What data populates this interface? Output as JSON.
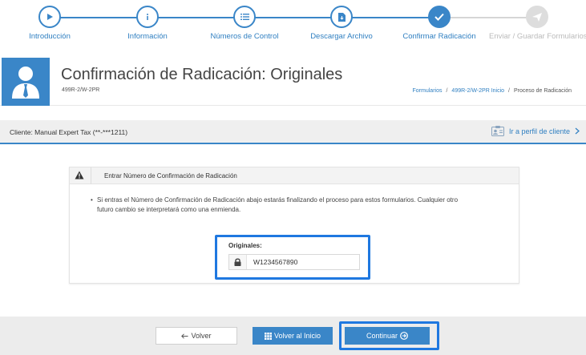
{
  "stepper": {
    "steps": [
      {
        "label": "Introducción",
        "icon": "play-icon",
        "state": "done"
      },
      {
        "label": "Información",
        "icon": "info-icon",
        "state": "done"
      },
      {
        "label": "Números de Control",
        "icon": "list-icon",
        "state": "done"
      },
      {
        "label": "Descargar Archivo",
        "icon": "file-download-icon",
        "state": "done"
      },
      {
        "label": "Confirmar Radicación",
        "icon": "check-icon",
        "state": "active"
      },
      {
        "label": "Enviar / Guardar Formularios",
        "icon": "send-icon",
        "state": "disabled"
      }
    ]
  },
  "header": {
    "title": "Confirmación de Radicación: Originales",
    "subtitle": "499R-2/W-2PR",
    "breadcrumb": [
      {
        "label": "Formularios",
        "link": true
      },
      {
        "label": "499R-2/W-2PR Inicio",
        "link": true
      },
      {
        "label": "Proceso de Radicación",
        "link": false
      }
    ]
  },
  "client": {
    "text": "Cliente: Manual Expert Tax (**-***1211)",
    "profile_link": "Ir a perfil de cliente"
  },
  "panel": {
    "title": "Entrar Número de Confirmación de Radicación",
    "message": "Si entras el Número de Confirmación de Radicación abajo estarás finalizando el proceso para estos formularios. Cualquier otro futuro cambio se interpretará como una enmienda.",
    "field_label": "Originales:",
    "field_value": "W1234567890"
  },
  "footer": {
    "back_label": "Volver",
    "home_label": "Volver al Inicio",
    "continue_label": "Continuar"
  },
  "colors": {
    "accent": "#3a86c8",
    "highlight": "#1f78e0",
    "disabled": "#dddddd"
  }
}
